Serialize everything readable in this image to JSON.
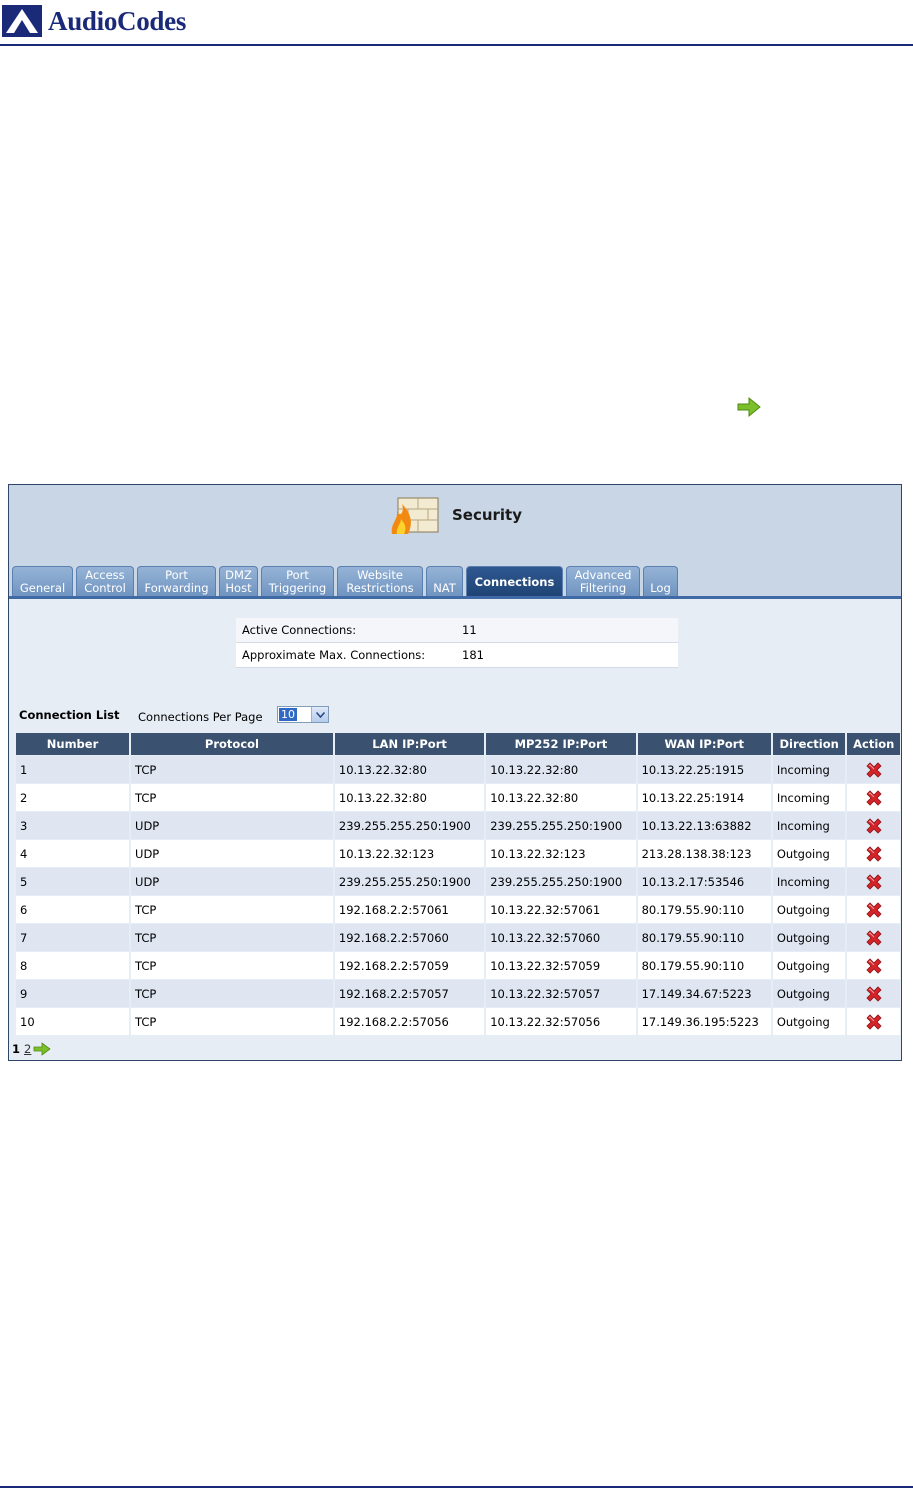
{
  "brand": {
    "name": "AudioCodes",
    "color": "#1b2a78"
  },
  "page_title": "Security",
  "tabs": [
    {
      "label": "General",
      "active": false
    },
    {
      "label": "Access\nControl",
      "active": false
    },
    {
      "label": "Port\nForwarding",
      "active": false
    },
    {
      "label": "DMZ\nHost",
      "active": false
    },
    {
      "label": "Port\nTriggering",
      "active": false
    },
    {
      "label": "Website\nRestrictions",
      "active": false
    },
    {
      "label": "NAT",
      "active": false
    },
    {
      "label": "Connections",
      "active": true
    },
    {
      "label": "Advanced\nFiltering",
      "active": false
    },
    {
      "label": "Log",
      "active": false
    }
  ],
  "summary": {
    "active_label": "Active Connections:",
    "active_value": "11",
    "max_label": "Approximate Max. Connections:",
    "max_value": "181"
  },
  "list": {
    "label": "Connection List",
    "per_page_label": "Connections Per Page",
    "per_page_value": "10"
  },
  "table": {
    "headers": [
      "Number",
      "Protocol",
      "LAN IP:Port",
      "MP252 IP:Port",
      "WAN IP:Port",
      "Direction",
      "Action"
    ],
    "rows": [
      [
        "1",
        "TCP",
        "10.13.22.32:80",
        "10.13.22.32:80",
        "10.13.22.25:1915",
        "Incoming"
      ],
      [
        "2",
        "TCP",
        "10.13.22.32:80",
        "10.13.22.32:80",
        "10.13.22.25:1914",
        "Incoming"
      ],
      [
        "3",
        "UDP",
        "239.255.255.250:1900",
        "239.255.255.250:1900",
        "10.13.22.13:63882",
        "Incoming"
      ],
      [
        "4",
        "UDP",
        "10.13.22.32:123",
        "10.13.22.32:123",
        "213.28.138.38:123",
        "Outgoing"
      ],
      [
        "5",
        "UDP",
        "239.255.255.250:1900",
        "239.255.255.250:1900",
        "10.13.2.17:53546",
        "Incoming"
      ],
      [
        "6",
        "TCP",
        "192.168.2.2:57061",
        "10.13.22.32:57061",
        "80.179.55.90:110",
        "Outgoing"
      ],
      [
        "7",
        "TCP",
        "192.168.2.2:57060",
        "10.13.22.32:57060",
        "80.179.55.90:110",
        "Outgoing"
      ],
      [
        "8",
        "TCP",
        "192.168.2.2:57059",
        "10.13.22.32:57059",
        "80.179.55.90:110",
        "Outgoing"
      ],
      [
        "9",
        "TCP",
        "192.168.2.2:57057",
        "10.13.22.32:57057",
        "17.149.34.67:5223",
        "Outgoing"
      ],
      [
        "10",
        "TCP",
        "192.168.2.2:57056",
        "10.13.22.32:57056",
        "17.149.36.195:5223",
        "Outgoing"
      ]
    ]
  },
  "pager": {
    "current": "1",
    "next": "2"
  },
  "icons": {
    "delete": "delete-x-icon",
    "next": "green-arrow-icon",
    "security": "firewall-icon"
  }
}
